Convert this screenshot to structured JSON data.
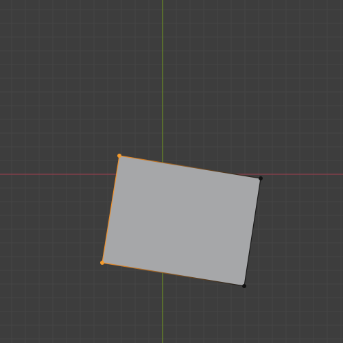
{
  "viewport": {
    "view": "top-orthographic",
    "mode": "edit-mode",
    "background_color": "#3d3d3d",
    "grid_minor_color": "#454545",
    "grid_major_color": "#4a4a4a",
    "x_axis_color": "#8e3f4c",
    "y_axis_color": "#6a8c25",
    "face_color": "#a6a7a9",
    "edge_color": "#1a1a1a",
    "selected_edge_color": "#f0902b",
    "selected_vertex_color": "#f39a2b",
    "vertex_color": "#111111"
  },
  "mesh": {
    "type": "plane",
    "vertex_count": 4,
    "edge_count": 4,
    "face_count": 1,
    "selected_vertex_count": 2,
    "vertices": [
      {
        "id": "v0",
        "selected": true
      },
      {
        "id": "v1",
        "selected": false
      },
      {
        "id": "v2",
        "selected": false
      },
      {
        "id": "v3",
        "selected": true
      }
    ]
  }
}
